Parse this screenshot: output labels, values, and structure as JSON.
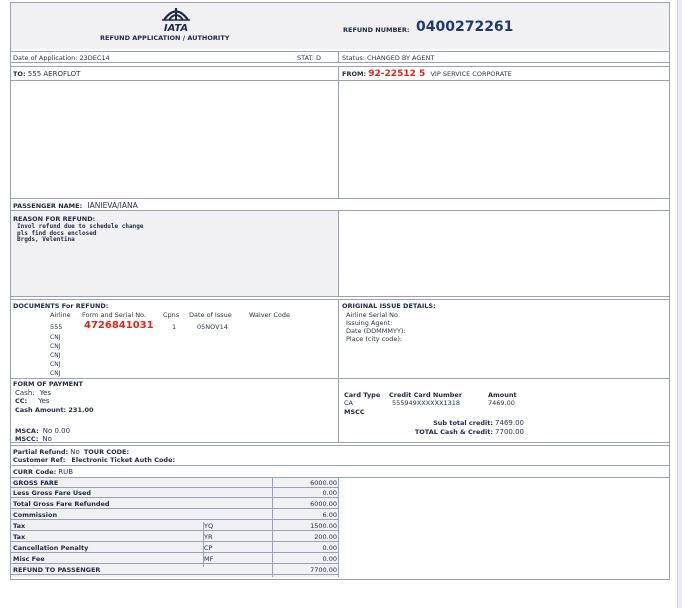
{
  "header": {
    "logo_text": "IATA",
    "form_title": "REFUND APPLICATION / AUTHORITY",
    "refund_number_label": "REFUND NUMBER:",
    "refund_number": "0400272261"
  },
  "info_bar": {
    "date_of_application": "Date of Application: 23DEC14",
    "stat": "STAT: D",
    "status": "Status: CHANGED BY AGENT"
  },
  "to": {
    "label": "TO:",
    "value": "555 AEROFLOT"
  },
  "from": {
    "label": "FROM:",
    "code": "92-22512 5",
    "name": "VIP SERVICE CORPORATE"
  },
  "passenger": {
    "label": "PASSENGER NAME:",
    "value": "IANIEVA/IANA"
  },
  "reason": {
    "label": "REASON FOR REFUND:",
    "lines": [
      "Invol refund due to schedule change",
      "pls find docs enclosed",
      "Brgds, Velentina"
    ]
  },
  "documents": {
    "label": "DOCUMENTS For REFUND:",
    "headers": [
      "Airline",
      "Form and Serial No.",
      "Cpns",
      "Date of Issue",
      "Waiver Code"
    ],
    "airline": "555",
    "serial": "4726841031",
    "cpns": "1",
    "date_of_issue": "05NOV14",
    "cnj": [
      "CNJ",
      "CNJ",
      "CNJ",
      "CNJ",
      "CNJ"
    ]
  },
  "original_issue": {
    "label": "ORIGINAL ISSUE DETAILS:",
    "lines": [
      "Airline  Serial No",
      "Issuing Agent:",
      "Date (DDMMMYY):",
      "Place (city code):"
    ]
  },
  "payment": {
    "label": "FORM OF PAYMENT",
    "cash_label": "Cash:",
    "cash_value": "Yes",
    "cc_label": "CC:",
    "cc_value": "Yes",
    "cash_amount": "Cash Amount: 231.00",
    "msca_label": "MSCA:",
    "msca_value": "No 0.00",
    "mscc_label": "MSCC:",
    "mscc_value": "No"
  },
  "card": {
    "headers": [
      "Card Type",
      "Credit Card Number",
      "Amount"
    ],
    "type": "CA",
    "number": "555949XXXXXX1318",
    "amount": "7469.00",
    "mscc": "MSCC",
    "subtotal_label": "Sub total credit:",
    "subtotal": "7469.00",
    "total_label": "TOTAL Cash & Credit:",
    "total": "7700.00"
  },
  "misc": {
    "partial_refund_label": "Partial Refund:",
    "partial_refund_value": "No",
    "tour_code": "TOUR CODE:",
    "customer_ref": "Customer Ref:",
    "etkt_auth": "Electronic Ticket Auth Code:",
    "curr_label": "CURR Code:",
    "curr_value": "RUB"
  },
  "financials": [
    {
      "label": "GROSS FARE",
      "code": "",
      "amount": "6000.00"
    },
    {
      "label": "Less Gross Fare Used",
      "code": "",
      "amount": "0.00"
    },
    {
      "label": "Total Gross Fare Refunded",
      "code": "",
      "amount": "6000.00"
    },
    {
      "label": "Commission",
      "code": "",
      "amount": "6.00"
    },
    {
      "label": "Tax",
      "code": "YQ",
      "amount": "1500.00"
    },
    {
      "label": "Tax",
      "code": "YR",
      "amount": "200.00"
    },
    {
      "label": "Cancellation Penalty",
      "code": "CP",
      "amount": "0.00"
    },
    {
      "label": "Misc Fee",
      "code": "MF",
      "amount": "0.00"
    },
    {
      "label": "REFUND TO PASSENGER",
      "code": "",
      "amount": "7700.00"
    }
  ]
}
